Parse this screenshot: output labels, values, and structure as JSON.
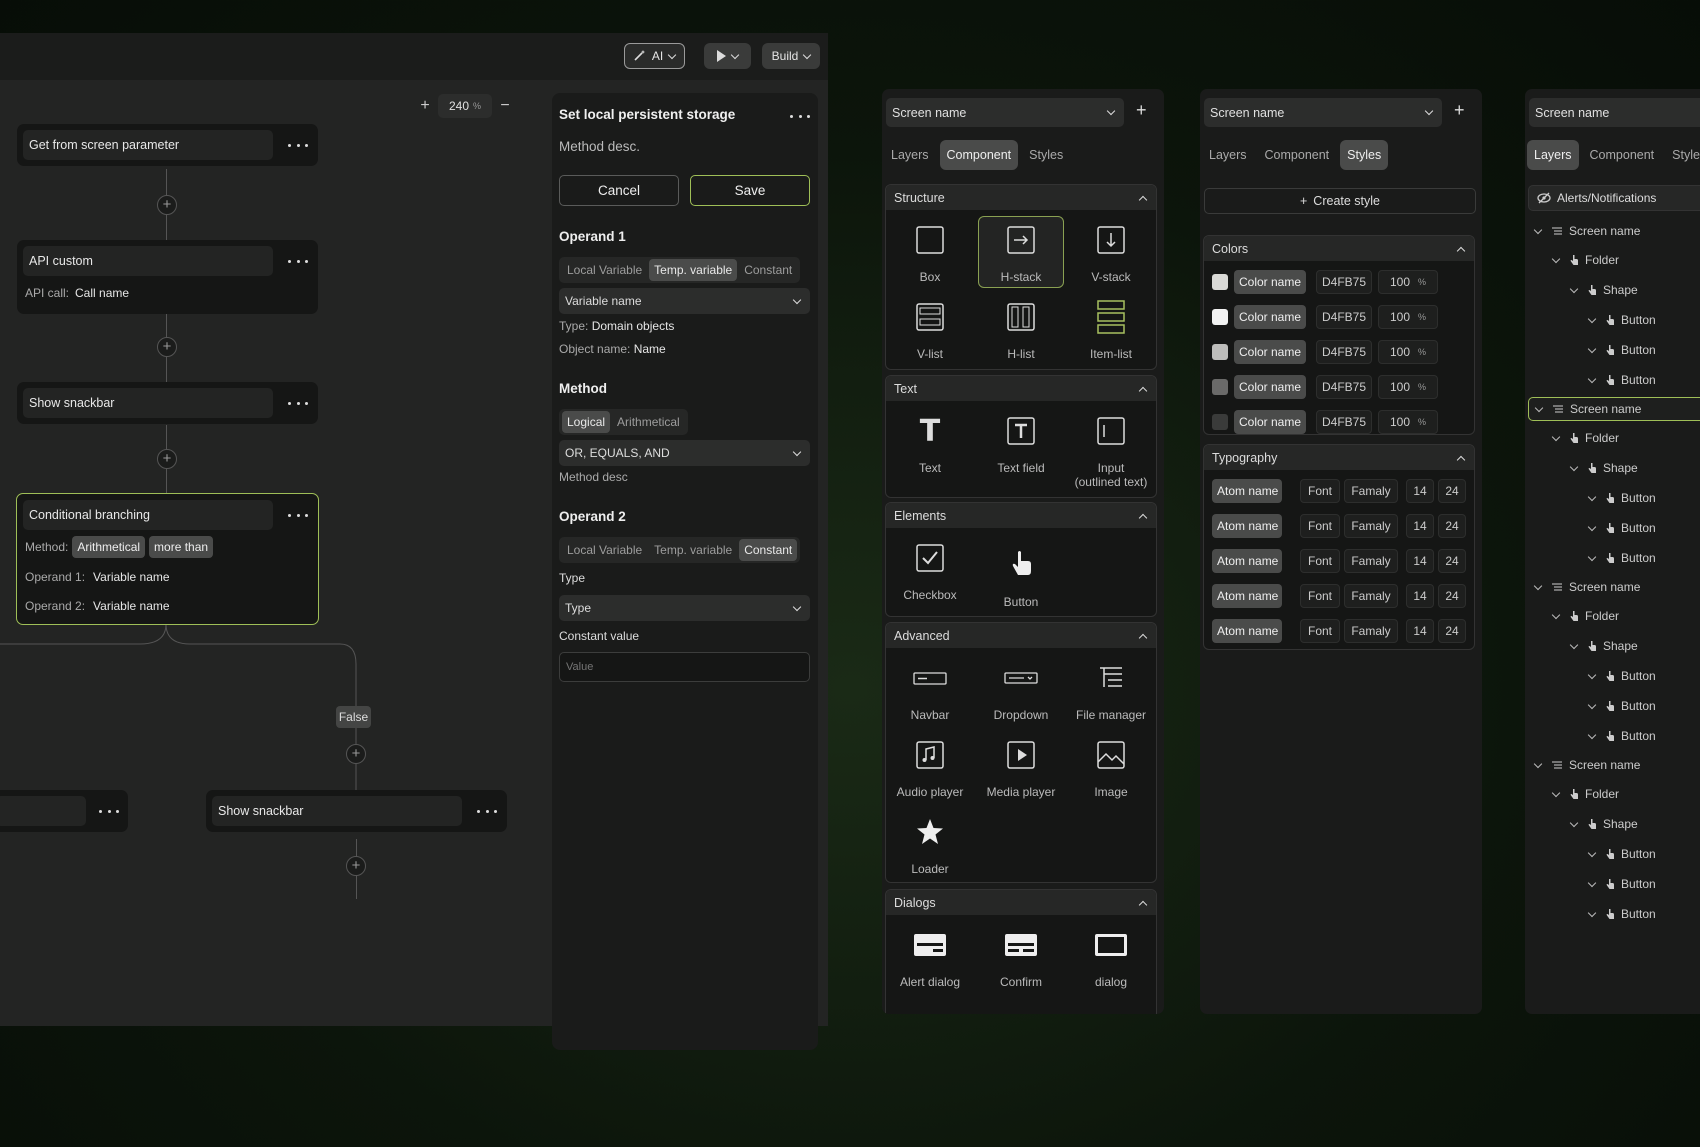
{
  "toolbar": {
    "ai_label": "AI",
    "build_label": "Build"
  },
  "zoom": {
    "value": "240",
    "unit": "%",
    "plus": "+",
    "minus": "−"
  },
  "nodes": {
    "n1": {
      "title": "Get from screen parameter"
    },
    "n2": {
      "title": "API custom",
      "row_label": "API call:",
      "row_value": "Call name"
    },
    "n3": {
      "title": "Show snackbar"
    },
    "n4": {
      "title": "Conditional branching",
      "method_label": "Method:",
      "chip1": "Arithmetical",
      "chip2": "more than",
      "op1_label": "Operand 1:",
      "op1_value": "Variable name",
      "op2_label": "Operand 2:",
      "op2_value": "Variable name"
    },
    "false_label": "False",
    "n6": {
      "title": "Show snackbar"
    }
  },
  "props": {
    "title": "Set local persistent storage",
    "desc": "Method desc.",
    "cancel": "Cancel",
    "save": "Save",
    "operand1": {
      "heading": "Operand 1",
      "segments": [
        "Local Variable",
        "Temp. variable",
        "Constant"
      ],
      "active": "Temp. variable",
      "select": "Variable name",
      "type_label": "Type:",
      "type_value": "Domain objects",
      "obj_label": "Object name:",
      "obj_value": "Name"
    },
    "method": {
      "heading": "Method",
      "segments": [
        "Logical",
        "Arithmetical"
      ],
      "active": "Logical",
      "select": "OR, EQUALS, AND",
      "desc": "Method desc"
    },
    "operand2": {
      "heading": "Operand 2",
      "segments": [
        "Local Variable",
        "Temp. variable",
        "Constant"
      ],
      "active": "Constant",
      "type_label": "Type",
      "type_select": "Type",
      "const_label": "Constant value",
      "const_placeholder": "Value"
    }
  },
  "component_panel": {
    "screen": "Screen name",
    "tabs": [
      "Layers",
      "Component",
      "Styles"
    ],
    "active_tab": "Component",
    "groups": {
      "structure": {
        "title": "Structure",
        "items": [
          "Box",
          "H-stack",
          "V-stack",
          "V-list",
          "H-list",
          "Item-list"
        ]
      },
      "text": {
        "title": "Text",
        "items": [
          "Text",
          "Text field",
          "Input",
          "(outlined text)"
        ]
      },
      "elements": {
        "title": "Elements",
        "items": [
          "Checkbox",
          "Button"
        ]
      },
      "advanced": {
        "title": "Advanced",
        "items": [
          "Navbar",
          "Dropdown",
          "File manager",
          "Audio player",
          "Media player",
          "Image",
          "Loader"
        ]
      },
      "dialogs": {
        "title": "Dialogs",
        "items": [
          "Alert dialog",
          "Confirm",
          "dialog"
        ]
      }
    }
  },
  "styles_panel": {
    "screen": "Screen name",
    "tabs": [
      "Layers",
      "Component",
      "Styles"
    ],
    "active_tab": "Styles",
    "create": "Create style",
    "colors_title": "Colors",
    "colors": [
      {
        "name": "Color name",
        "hex": "D4FB75",
        "opacity": "100",
        "unit": "%",
        "swatch": "#d9d9d6"
      },
      {
        "name": "Color name",
        "hex": "D4FB75",
        "opacity": "100",
        "unit": "%",
        "swatch": "#f2f2f2"
      },
      {
        "name": "Color name",
        "hex": "D4FB75",
        "opacity": "100",
        "unit": "%",
        "swatch": "#bdbdbb"
      },
      {
        "name": "Color name",
        "hex": "D4FB75",
        "opacity": "100",
        "unit": "%",
        "swatch": "#6a6a69"
      },
      {
        "name": "Color name",
        "hex": "D4FB75",
        "opacity": "100",
        "unit": "%",
        "swatch": "#3a3b3a"
      }
    ],
    "typo_title": "Typography",
    "typography": [
      {
        "name": "Atom name",
        "font": "Font",
        "family": "Famaly",
        "size": "14",
        "line": "24"
      },
      {
        "name": "Atom name",
        "font": "Font",
        "family": "Famaly",
        "size": "14",
        "line": "24"
      },
      {
        "name": "Atom name",
        "font": "Font",
        "family": "Famaly",
        "size": "14",
        "line": "24"
      },
      {
        "name": "Atom name",
        "font": "Font",
        "family": "Famaly",
        "size": "14",
        "line": "24"
      },
      {
        "name": "Atom name",
        "font": "Font",
        "family": "Famaly",
        "size": "14",
        "line": "24"
      }
    ]
  },
  "layers_panel": {
    "screen": "Screen name",
    "tabs": [
      "Layers",
      "Component",
      "Style"
    ],
    "active_tab": "Layers",
    "alerts": "Alerts/Notifications",
    "tree": [
      "Screen name",
      "Folder",
      "Shape",
      "Button",
      "Button",
      "Button",
      "Screen name",
      "Folder",
      "Shape",
      "Button",
      "Button",
      "Button",
      "Screen name",
      "Folder",
      "Shape",
      "Button",
      "Button",
      "Button",
      "Screen name",
      "Folder",
      "Shape",
      "Button",
      "Button",
      "Button"
    ]
  },
  "colors": {
    "accent": "#9fbf57",
    "panel": "#1a1b1a",
    "canvas": "#232423"
  }
}
